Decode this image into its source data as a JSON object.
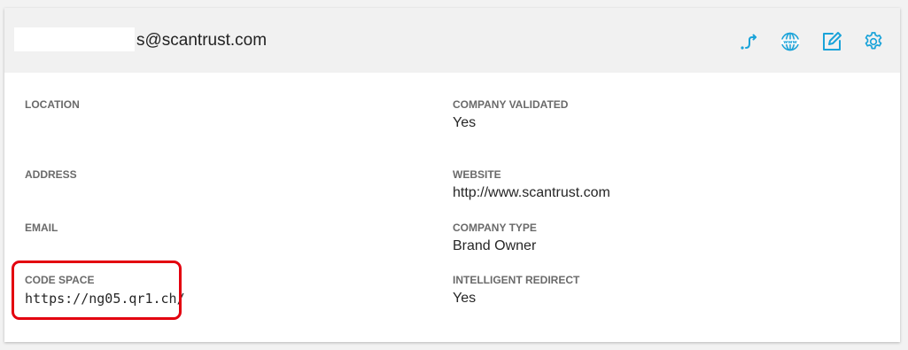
{
  "header": {
    "account_email_suffix": "s@scantrust.com",
    "icons": [
      {
        "name": "redirect-icon",
        "color": "#1aa3d9"
      },
      {
        "name": "www-globe-icon",
        "color": "#1aa3d9"
      },
      {
        "name": "edit-icon",
        "color": "#1aa3d9"
      },
      {
        "name": "gear-icon",
        "color": "#1aa3d9"
      }
    ]
  },
  "left_fields": {
    "location": {
      "label": "LOCATION",
      "value": ""
    },
    "address": {
      "label": "ADDRESS",
      "value": ""
    },
    "email": {
      "label": "EMAIL",
      "value": ""
    },
    "code_space": {
      "label": "CODE SPACE",
      "value": "https://ng05.qr1.ch/"
    }
  },
  "right_fields": {
    "company_validated": {
      "label": "COMPANY VALIDATED",
      "value": "Yes"
    },
    "website": {
      "label": "WEBSITE",
      "value": "http://www.scantrust.com"
    },
    "company_type": {
      "label": "COMPANY TYPE",
      "value": "Brand Owner"
    },
    "intelligent_redirect": {
      "label": "INTELLIGENT REDIRECT",
      "value": "Yes"
    }
  },
  "colors": {
    "accent": "#1aa3d9",
    "highlight": "#e3000f",
    "header_bg": "#f1f1f1"
  }
}
